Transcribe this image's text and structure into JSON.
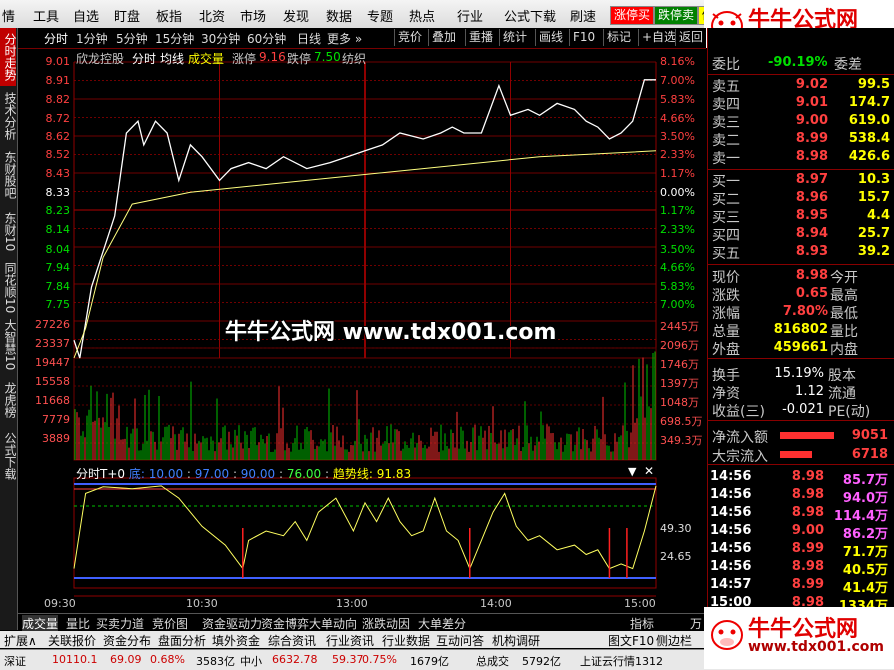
{
  "menu": {
    "items": [
      "情",
      "工具",
      "自选",
      "盯盘",
      "板指",
      "北资",
      "市场",
      "发现",
      "数据",
      "专题",
      "热点",
      "行业",
      "公式下载",
      "刷速"
    ],
    "tags": [
      {
        "label": "涨停买",
        "bg": "#ff0000",
        "fg": "#fff"
      },
      {
        "label": "跌停卖",
        "bg": "#008000",
        "fg": "#fff"
      },
      {
        "label": "做",
        "bg": "#ffff00",
        "fg": "#000"
      }
    ]
  },
  "logo": {
    "text": "牛牛公式网",
    "url": "www.tdx001.com"
  },
  "left_tabs": [
    "分时走势",
    "技术分析",
    "东财股吧",
    "东财10",
    "同花顺10",
    "大智慧10",
    "龙虎榜",
    "公式下载"
  ],
  "period_bar": {
    "periods": [
      "分时",
      "1分钟",
      "5分钟",
      "15分钟",
      "30分钟",
      "60分钟",
      "日线",
      "更多"
    ],
    "tools": [
      "竞价",
      "叠加",
      "重播",
      "统计",
      "画线",
      "F10",
      "标记",
      "+自选",
      "返回"
    ]
  },
  "chart_header": {
    "name": "欣龙控股",
    "mode": "分时",
    "avg": "均线",
    "vol": "成交量",
    "up_label": "涨停",
    "up": "9.16",
    "down_label": "跌停",
    "down": "7.50",
    "brand": "纺织"
  },
  "price_axis": [
    "9.01",
    "8.91",
    "8.82",
    "8.72",
    "8.62",
    "8.52",
    "8.43",
    "8.33",
    "8.23",
    "8.14",
    "8.04",
    "7.94",
    "7.84",
    "7.75"
  ],
  "pct_axis": [
    "8.16%",
    "7.00%",
    "5.83%",
    "4.66%",
    "3.50%",
    "2.33%",
    "1.17%",
    "0.00%",
    "1.17%",
    "2.33%",
    "3.50%",
    "4.66%",
    "5.83%",
    "7.00%"
  ],
  "vol_axis_left": [
    "27226",
    "23337",
    "19447",
    "15558",
    "11668",
    "7779",
    "3889"
  ],
  "vol_axis_right": [
    "2445万",
    "2096万",
    "1746万",
    "1397万",
    "1048万",
    "698.5万",
    "349.3万"
  ],
  "indicator": {
    "name": "分时T+0",
    "low_label": "底:",
    "v1": "10.00",
    "v2": "97.00",
    "v3": "90.00",
    "v4": "76.00",
    "trend_label": "趋势线:",
    "trend": "91.83",
    "axis": [
      "49.30",
      "24.65"
    ]
  },
  "time_labels": [
    "09:30",
    "10:30",
    "13:00",
    "14:00",
    "15:00"
  ],
  "watermark": "牛牛公式网 www.tdx001.com",
  "bottom_tabs1": [
    "成交量",
    "量比",
    "买卖力道",
    "竞价图",
    "资金驱动力",
    "资金博弈",
    "大单动向",
    "涨跌动因",
    "大单差分"
  ],
  "bottom_tabs1_right": [
    "指标",
    "万"
  ],
  "bottom_tabs2": [
    "扩展∧",
    "关联报价",
    "资金分布",
    "盘面分析",
    "填外资金",
    "综合资讯",
    "行业资讯",
    "行业数据",
    "互动问答",
    "机构调研"
  ],
  "bottom_tabs2_right": [
    "图文F10",
    "侧边栏"
  ],
  "status": [
    "深证",
    "10110.1",
    "69.09",
    "0.68%",
    "3583亿",
    "中小",
    "6632.78",
    "59.37",
    "0.75%",
    "1679亿",
    "总成交",
    "5792亿",
    "上证云行情1312"
  ],
  "right_panel": {
    "weibi_label": "委比",
    "weibi": "-90.19%",
    "weicha_label": "委差",
    "asks": [
      {
        "l": "卖五",
        "p": "9.02",
        "v": "99.5"
      },
      {
        "l": "卖四",
        "p": "9.01",
        "v": "174.7"
      },
      {
        "l": "卖三",
        "p": "9.00",
        "v": "619.0"
      },
      {
        "l": "卖二",
        "p": "8.99",
        "v": "538.4"
      },
      {
        "l": "卖一",
        "p": "8.98",
        "v": "426.6"
      }
    ],
    "bids": [
      {
        "l": "买一",
        "p": "8.97",
        "v": "10.3"
      },
      {
        "l": "买二",
        "p": "8.96",
        "v": "15.7"
      },
      {
        "l": "买三",
        "p": "8.95",
        "v": "4.4"
      },
      {
        "l": "买四",
        "p": "8.94",
        "v": "25.7"
      },
      {
        "l": "买五",
        "p": "8.93",
        "v": "39.2"
      }
    ],
    "stats": [
      {
        "l1": "现价",
        "v1": "8.98",
        "l2": "今开",
        "v2": ""
      },
      {
        "l1": "涨跌",
        "v1": "0.65",
        "l2": "最高",
        "v2": ""
      },
      {
        "l1": "涨幅",
        "v1": "7.80%",
        "l2": "最低",
        "v2": ""
      },
      {
        "l1": "总量",
        "v1": "816802",
        "l2": "量比",
        "v2": ""
      },
      {
        "l1": "外盘",
        "v1": "459661",
        "l2": "内盘",
        "v2": ""
      }
    ],
    "stats2": [
      {
        "l1": "换手",
        "v1": "15.19%",
        "l2": "股本"
      },
      {
        "l1": "净资",
        "v1": "1.12",
        "l2": "流通"
      },
      {
        "l1": "收益(三)",
        "v1": "-0.021",
        "l2": "PE(动)"
      }
    ],
    "flows": [
      {
        "l": "净流入额",
        "v": "9051"
      },
      {
        "l": "大宗流入",
        "v": "6718"
      }
    ],
    "ticks": [
      {
        "t": "14:56",
        "p": "8.98",
        "v": "85.7万"
      },
      {
        "t": "14:56",
        "p": "8.98",
        "v": "94.0万"
      },
      {
        "t": "14:56",
        "p": "8.98",
        "v": "114.4万"
      },
      {
        "t": "14:56",
        "p": "9.00",
        "v": "86.2万"
      },
      {
        "t": "14:56",
        "p": "8.99",
        "v": "71.7万"
      },
      {
        "t": "14:56",
        "p": "8.98",
        "v": "40.5万"
      },
      {
        "t": "14:57",
        "p": "8.99",
        "v": "41.4万"
      },
      {
        "t": "15:00",
        "p": "8.98",
        "v": "1334万"
      }
    ]
  }
}
